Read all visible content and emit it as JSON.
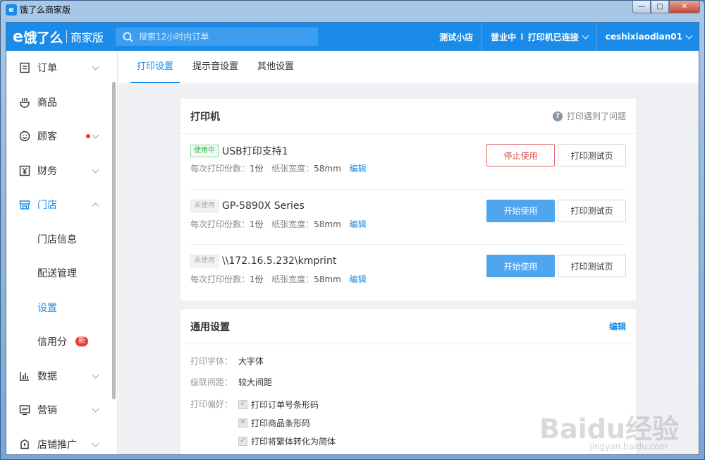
{
  "window": {
    "title": "饿了么商家版",
    "app_icon": "e"
  },
  "header": {
    "logo_main": "饿了么",
    "logo_sub": "商家版",
    "search_placeholder": "搜索12小时内订单",
    "store_name": "测试小店",
    "business_status": "营业中",
    "printer_status": "打印机已连接",
    "username": "ceshixiaodian01"
  },
  "sidebar": {
    "items": [
      {
        "label": "订单",
        "icon": "order-icon"
      },
      {
        "label": "商品",
        "icon": "goods-icon"
      },
      {
        "label": "顾客",
        "icon": "smile-icon"
      },
      {
        "label": "财务",
        "icon": "yen-icon"
      },
      {
        "label": "门店",
        "icon": "store-icon"
      },
      {
        "label": "门店信息"
      },
      {
        "label": "配送管理"
      },
      {
        "label": "设置"
      },
      {
        "label": "信用分",
        "badge": "新"
      },
      {
        "label": "数据",
        "icon": "bar-chart-icon"
      },
      {
        "label": "营销",
        "icon": "trend-icon"
      },
      {
        "label": "店铺推广",
        "icon": "promote-icon"
      }
    ]
  },
  "tabs": [
    {
      "label": "打印设置"
    },
    {
      "label": "提示音设置"
    },
    {
      "label": "其他设置"
    }
  ],
  "printer_card": {
    "title": "打印机",
    "help": "打印遇到了问题",
    "printers": [
      {
        "status": "使用中",
        "name": "USB打印支持1",
        "copies_label": "每次打印份数：",
        "copies": "1份",
        "width_label": "纸张宽度：",
        "width": "58mm",
        "edit": "编辑",
        "action": "停止使用",
        "test": "打印测试页"
      },
      {
        "status": "未使用",
        "name": "GP-5890X Series",
        "copies_label": "每次打印份数：",
        "copies": "1份",
        "width_label": "纸张宽度：",
        "width": "58mm",
        "edit": "编辑",
        "action": "开始使用",
        "test": "打印测试页"
      },
      {
        "status": "未使用",
        "name": "\\\\172.16.5.232\\kmprint",
        "copies_label": "每次打印份数：",
        "copies": "1份",
        "width_label": "纸张宽度：",
        "width": "58mm",
        "edit": "编辑",
        "action": "开始使用",
        "test": "打印测试页"
      }
    ]
  },
  "general_card": {
    "title": "通用设置",
    "edit": "编辑",
    "font_label": "打印字体：",
    "font_value": "大字体",
    "spacing_label": "级联间距：",
    "spacing_value": "较大间距",
    "pref_label": "打印偏好：",
    "prefs": [
      {
        "label": "打印订单号条形码",
        "checked": true
      },
      {
        "label": "打印商品条形码",
        "checked": false
      },
      {
        "label": "打印将繁体转化为简体",
        "checked": true
      }
    ]
  },
  "watermark": {
    "main": "Baidu经验",
    "sub": "jingyan.baidu.com"
  },
  "colors": {
    "brand": "#1a8be8",
    "danger": "#e04b4b",
    "primary_btn": "#4ea6ef",
    "success": "#37b24d"
  }
}
